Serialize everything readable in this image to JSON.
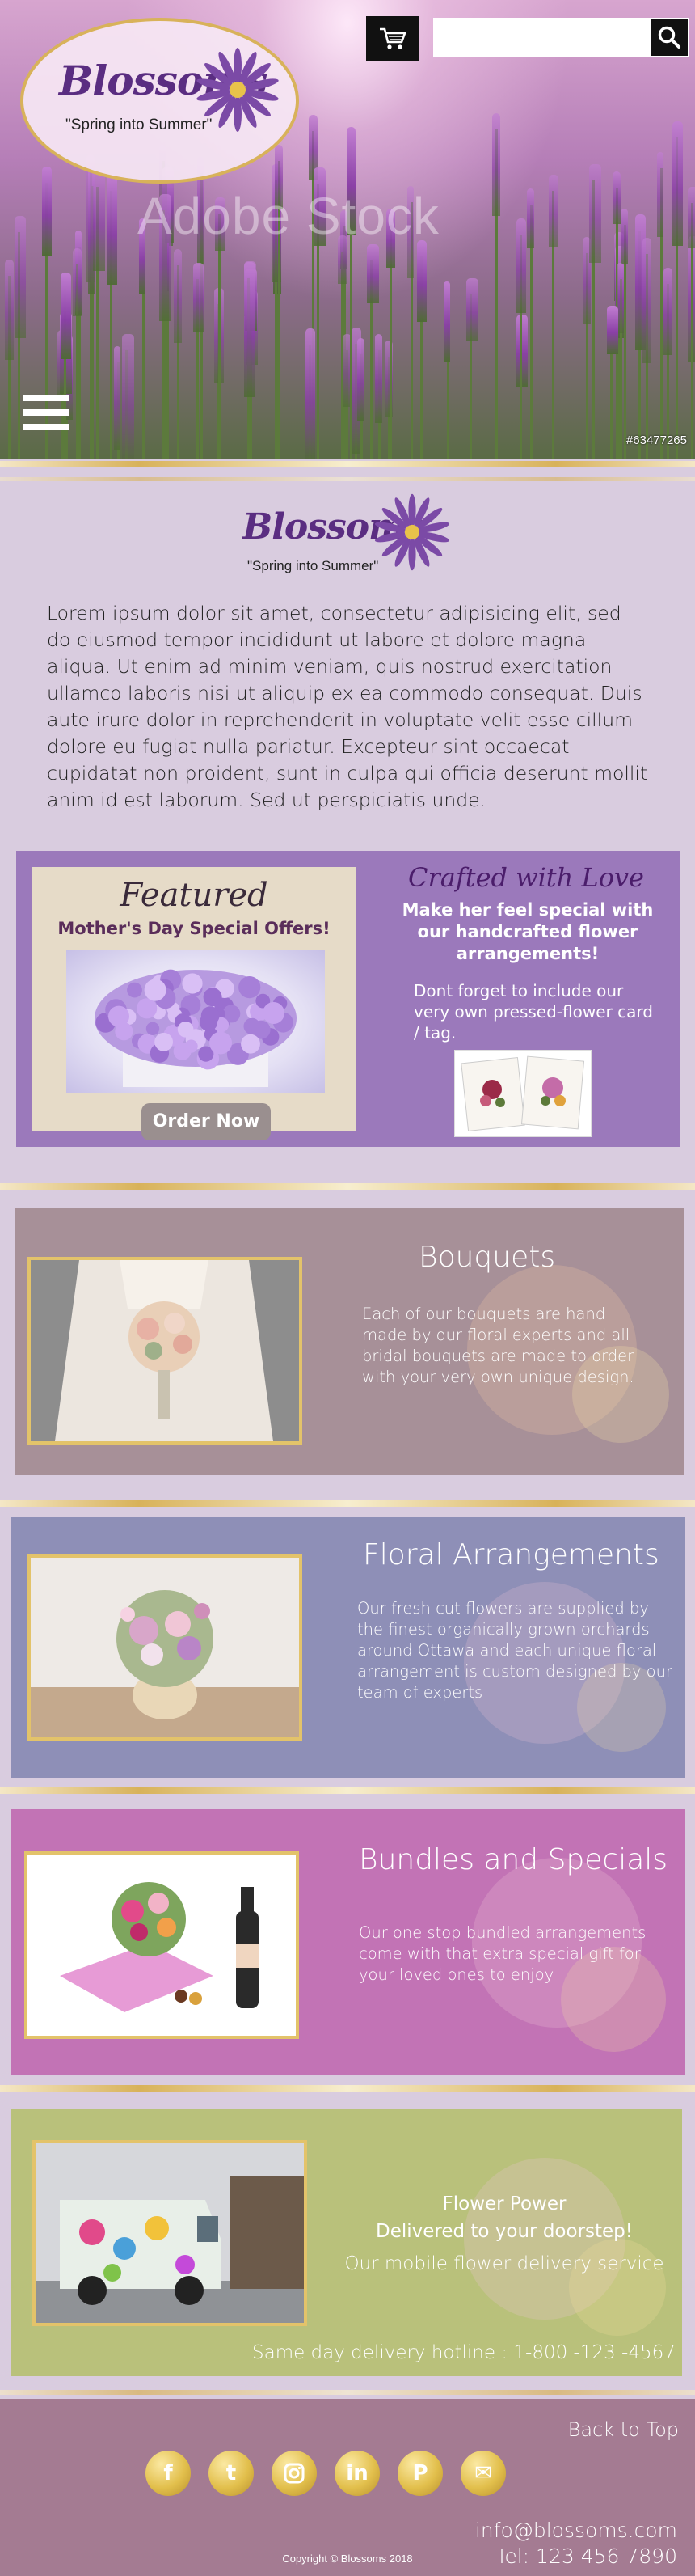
{
  "brand": {
    "name": "Blossoms",
    "tagline": "\"Spring into Summer\"",
    "accent": "#5a2d81",
    "gold": "#d8b25a"
  },
  "header": {
    "cart_icon": "shopping-cart-icon",
    "search_value": "",
    "search_icon": "search-icon",
    "menu_icon": "hamburger-menu-icon",
    "watermark": "Adobe Stock",
    "stock_id": "#63477265"
  },
  "intro": {
    "text": "Lorem ipsum dolor sit amet, consectetur adipisicing elit, sed do eiusmod tempor incididunt ut labore et dolore magna aliqua. Ut enim ad minim veniam, quis nostrud exercitation ullamco laboris nisi ut aliquip ex ea commodo consequat. Duis aute irure dolor in reprehenderit in voluptate velit esse cillum dolore eu fugiat nulla pariatur. Excepteur sint occaecat cupidatat non proident, sunt in culpa qui officia deserunt mollit anim id est laborum. Sed ut perspiciatis unde."
  },
  "featured": {
    "title": "Featured",
    "subtitle": "Mother's Day Special Offers!",
    "button": "Order Now",
    "crafted_title": "Crafted with Love",
    "crafted_sub": "Make her feel special with our handcrafted flower arrangements!",
    "crafted_note": "Dont forget to include our very own pressed-flower card / tag."
  },
  "sections": {
    "bouquets": {
      "title": "Bouquets",
      "text": "Each of our bouquets are hand made by  our floral experts and all bridal bouquets are made to order with your very own  unique  design.",
      "bg": "#a79098"
    },
    "arrangements": {
      "title": "Floral Arrangements",
      "text": "Our fresh cut flowers are supplied by the finest organically grown orchards around Ottawa and each  unique floral arrangement is custom designed by our team of experts",
      "bg": "#8e8fb7"
    },
    "bundles": {
      "title": "Bundles and Specials",
      "text": "Our one stop bundled arrangements come with that extra special gift for your loved ones to enjoy",
      "bg": "#c273b5"
    },
    "delivery": {
      "title_line1": "Flower Power",
      "title_line2": "Delivered to your doorstep!",
      "tagline": "Our mobile flower delivery service",
      "hotline": "Same day delivery hotline  :  1-800 -123 -4567",
      "bg": "#b9c17b"
    }
  },
  "footer": {
    "back_to_top": "Back to Top",
    "social": [
      {
        "icon": "facebook-icon",
        "glyph": "f"
      },
      {
        "icon": "twitter-icon",
        "glyph": "t"
      },
      {
        "icon": "instagram-icon",
        "glyph": ""
      },
      {
        "icon": "linkedin-icon",
        "glyph": "in"
      },
      {
        "icon": "pinterest-icon",
        "glyph": "P"
      },
      {
        "icon": "email-icon",
        "glyph": "✉"
      }
    ],
    "email": "info@blossoms.com",
    "phone": "Tel: 123 456 7890",
    "copyright": "Copyright © Blossoms 2018"
  }
}
